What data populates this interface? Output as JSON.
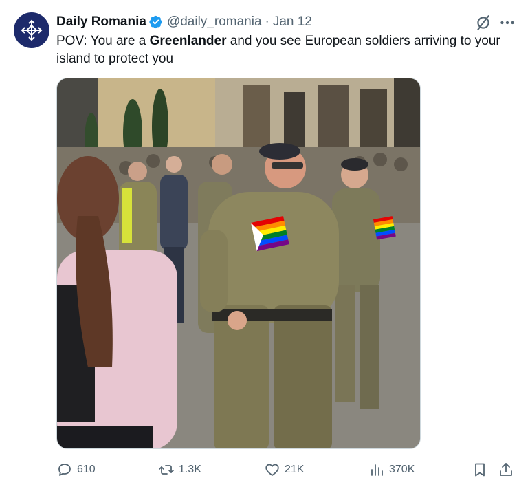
{
  "author": {
    "display_name": "Daily Romania",
    "handle": "@daily_romania",
    "separator": "·",
    "date": "Jan 12",
    "verified": true,
    "avatar_icon": "cross-logo-icon",
    "avatar_color": "#1d2a6b",
    "verified_color": "#1d9bf0"
  },
  "tweet": {
    "text_before": "POV: You are a ",
    "text_bold": "Greenlander",
    "text_after": " and you see European soldiers arriving to your island to protect you"
  },
  "media": {
    "type": "video-still",
    "description_icon": "parade-photo"
  },
  "actions": {
    "reply_count": "610",
    "retweet_count": "1.3K",
    "like_count": "21K",
    "views_count": "370K"
  },
  "icons": {
    "grok": "grok-icon",
    "more": "more-icon",
    "reply": "reply-icon",
    "retweet": "retweet-icon",
    "like": "heart-icon",
    "views": "views-icon",
    "bookmark": "bookmark-icon",
    "share": "share-icon"
  },
  "colors": {
    "text_primary": "#0f1419",
    "text_secondary": "#536471"
  }
}
